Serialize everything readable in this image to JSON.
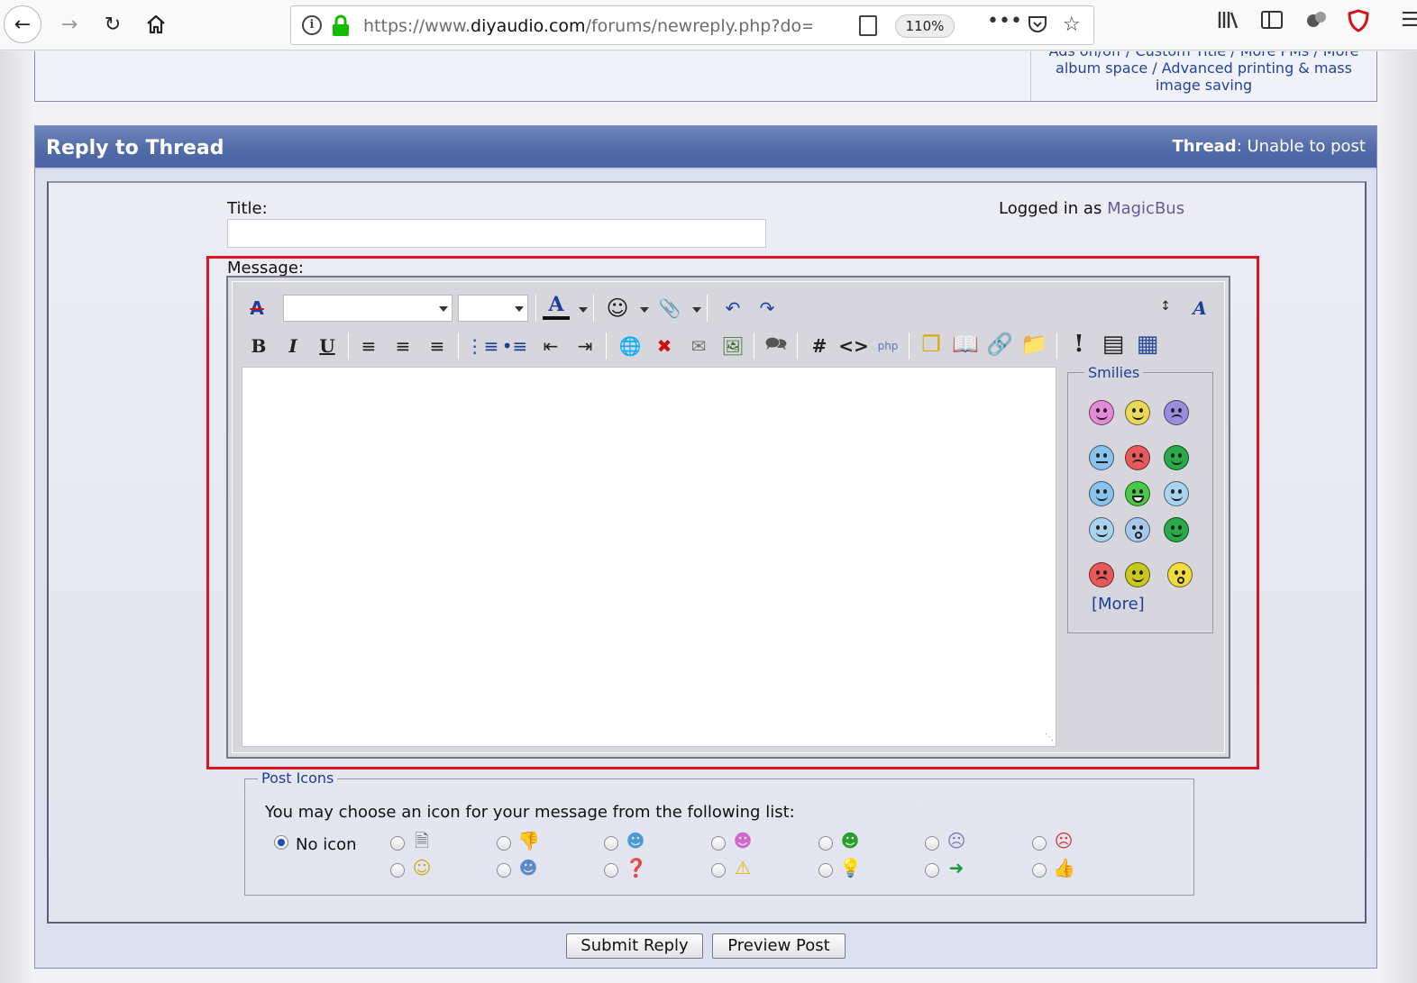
{
  "browser": {
    "url_prefix": "https://www.",
    "url_domain": "diyaudio.com",
    "url_rest": "/forums/newreply.php?do=",
    "zoom": "110%"
  },
  "top_box": {
    "lines": [
      "Ads on/off / Custom Title / More PMs / More",
      "album space / Advanced printing & mass",
      "image saving"
    ]
  },
  "reply_panel": {
    "title": "Reply to Thread",
    "thread_label": "Thread",
    "thread_name": ": Unable to post"
  },
  "form": {
    "title_label": "Title:",
    "title_value": "",
    "logged_in_prefix": "Logged in as ",
    "logged_in_user": "MagicBus",
    "message_label": "Message:",
    "message_value": ""
  },
  "editor": {
    "font_select_value": "",
    "size_select_value": "",
    "smilies_legend": "Smilies",
    "more_link": "[More]"
  },
  "post_icons": {
    "legend": "Post Icons",
    "instructions": "You may choose an icon for your message from the following list:",
    "no_icon_label": "No icon",
    "selected": "No icon"
  },
  "buttons": {
    "submit": "Submit Reply",
    "preview": "Preview Post"
  },
  "colors": {
    "header_blue": "#506aa8",
    "link_blue": "#1e3e9b",
    "highlight_red": "#e0141e",
    "username": "#6a5a98"
  }
}
